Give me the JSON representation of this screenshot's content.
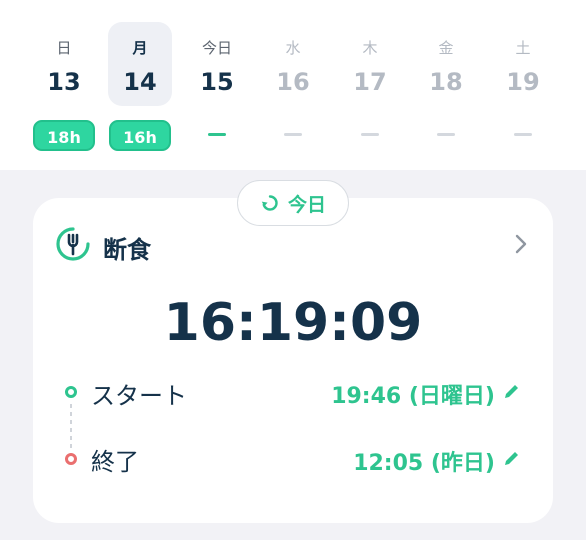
{
  "week": {
    "days": [
      {
        "weekday": "日",
        "date": "13",
        "badge": "18h",
        "state": "past"
      },
      {
        "weekday": "月",
        "date": "14",
        "badge": "16h",
        "state": "selected"
      },
      {
        "weekday": "今日",
        "date": "15",
        "badge": "–",
        "state": "today"
      },
      {
        "weekday": "水",
        "date": "16",
        "badge": "–",
        "state": "future"
      },
      {
        "weekday": "木",
        "date": "17",
        "badge": "–",
        "state": "future"
      },
      {
        "weekday": "金",
        "date": "18",
        "badge": "–",
        "state": "future"
      },
      {
        "weekday": "土",
        "date": "19",
        "badge": "–",
        "state": "future"
      }
    ]
  },
  "today_button": {
    "label": "今日",
    "icon": "rotate-back-icon"
  },
  "card": {
    "title": "断食",
    "icon": "fork-ring-icon",
    "timer": "16:19:09",
    "start": {
      "label": "スタート",
      "value": "19:46 (日曜日)"
    },
    "end": {
      "label": "終了",
      "value": "12:05 (昨日)"
    }
  },
  "colors": {
    "accent": "#2ec48f",
    "badge": "#2ed6a0",
    "text": "#15324a",
    "end_dot": "#ea6f6f",
    "background": "#f2f2f6"
  }
}
